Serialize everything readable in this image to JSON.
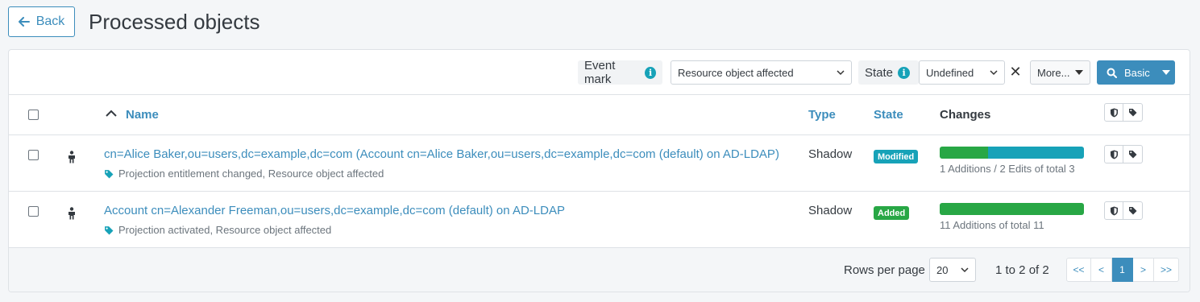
{
  "header": {
    "back_label": "Back",
    "title": "Processed objects"
  },
  "toolbar": {
    "event_mark_label": "Event mark",
    "event_mark_value": "Resource object affected",
    "state_label": "State",
    "state_value": "Undefined",
    "more_label": "More...",
    "search_label": "Basic"
  },
  "table": {
    "headers": {
      "name": "Name",
      "type": "Type",
      "state": "State",
      "changes": "Changes"
    },
    "rows": [
      {
        "name": "cn=Alice Baker,ou=users,dc=example,dc=com (Account cn=Alice Baker,ou=users,dc=example,dc=com (default) on AD-LDAP)",
        "marks": "Projection entitlement changed, Resource object affected",
        "type": "Shadow",
        "state": "Modified",
        "state_color": "#17a2b8",
        "changes_text": "1 Additions / 2 Edits of total 3",
        "additions": 1,
        "edits": 2,
        "total": 3
      },
      {
        "name": "Account cn=Alexander Freeman,ou=users,dc=example,dc=com (default) on AD-LDAP",
        "marks": "Projection activated, Resource object affected",
        "type": "Shadow",
        "state": "Added",
        "state_color": "#28a745",
        "changes_text": "11 Additions of total 11",
        "additions": 11,
        "edits": 0,
        "total": 11
      }
    ]
  },
  "footer": {
    "rows_per_page_label": "Rows per page",
    "rows_per_page": "20",
    "range": "1 to 2 of 2",
    "pager": [
      "<<",
      "<",
      "1",
      ">",
      ">>"
    ],
    "current_page": "1"
  },
  "colors": {
    "accent": "#3c8dbc",
    "added": "#28a745",
    "modified": "#17a2b8"
  },
  "icons": [
    "arrow-left-icon",
    "info-icon",
    "chevron-down-icon",
    "close-icon",
    "search-icon",
    "sort-up-icon",
    "person-icon",
    "tag-icon",
    "shield-icon"
  ]
}
